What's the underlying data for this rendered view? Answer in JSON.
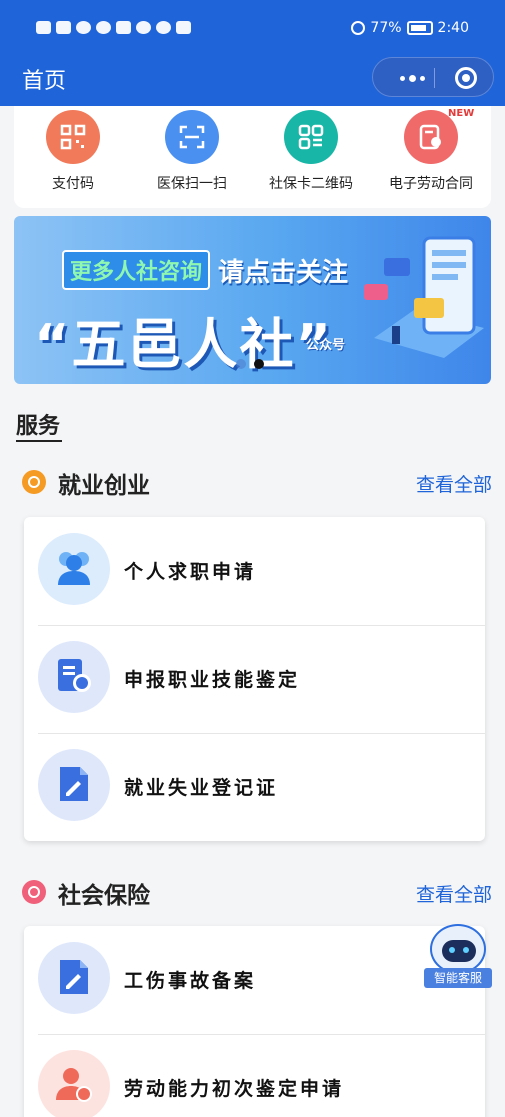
{
  "status_bar": {
    "battery": "77%",
    "time": "2:40",
    "more": "···"
  },
  "header": {
    "title": "首页"
  },
  "quick_actions": [
    {
      "label": "支付码",
      "icon": "qr-code-icon",
      "color": "#f07a5a"
    },
    {
      "label": "医保扫一扫",
      "icon": "scan-icon",
      "color": "#4a90f0"
    },
    {
      "label": "社保卡二维码",
      "icon": "qr-card-icon",
      "color": "#18b6a6"
    },
    {
      "label": "电子劳动合同",
      "icon": "contract-icon",
      "color": "#f06a6a",
      "badge": "NEW"
    }
  ],
  "banner": {
    "line1_pill": "更多人社咨询",
    "line1_text": "请点击关注",
    "line2": "“五邑人社”",
    "small": "公众号",
    "slides": 2,
    "active_slide": 2
  },
  "services_title": "服务",
  "sections": [
    {
      "title": "就业创业",
      "more": "查看全部",
      "items": [
        {
          "label": "个人求职申请",
          "icon": "people-icon"
        },
        {
          "label": "申报职业技能鉴定",
          "icon": "certificate-icon"
        },
        {
          "label": "就业失业登记证",
          "icon": "edit-document-icon"
        }
      ]
    },
    {
      "title": "社会保险",
      "more": "查看全部",
      "items": [
        {
          "label": "工伤事故备案",
          "icon": "edit-document-icon"
        },
        {
          "label": "劳动能力初次鉴定申请",
          "icon": "person-exchange-icon"
        }
      ]
    }
  ],
  "assistant": {
    "label": "智能客服"
  }
}
